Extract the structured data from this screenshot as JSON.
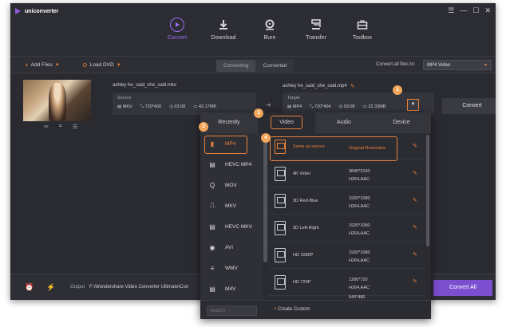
{
  "app": {
    "name": "uniconverter",
    "window_controls": [
      "☰",
      "—",
      "☐",
      "✕"
    ]
  },
  "nav": {
    "tabs": [
      {
        "label": "Convert",
        "icon": "convert-icon",
        "active": true
      },
      {
        "label": "Download",
        "icon": "download-icon"
      },
      {
        "label": "Burn",
        "icon": "burn-icon"
      },
      {
        "label": "Transfer",
        "icon": "transfer-icon"
      },
      {
        "label": "Toolbox",
        "icon": "toolbox-icon"
      }
    ]
  },
  "toolbar": {
    "add_files": "Add Files",
    "load_dvd": "Load DVD",
    "segment": [
      "Converting",
      "Converted"
    ],
    "convert_all_label": "Convert all files to:",
    "convert_all_value": "MP4 Video"
  },
  "file": {
    "source_name": "ashley he_said_she_said.mkx",
    "source_label": "Source",
    "source": {
      "format": "MKV",
      "resolution": "720*400",
      "duration": "03:08",
      "size": "42.17MB"
    },
    "target_name": "ashley he_said_she_said.mp4",
    "target_label": "Target",
    "target": {
      "format": "MP4",
      "resolution": "720*404",
      "duration": "03:08",
      "size": "22.33MB"
    },
    "convert_label": "Convert"
  },
  "bottom": {
    "output_label": "Output",
    "output_path": "F:\\Wondershare Video Converter Ultimate\\Con",
    "convert_all_label": "Convert All"
  },
  "popup": {
    "tabs": [
      "Recently",
      "Video",
      "Audio",
      "Device"
    ],
    "active_tab": "Video",
    "formats": [
      {
        "label": "MP4",
        "icon": "film-icon",
        "glyph": "▮"
      },
      {
        "label": "HEVC MP4",
        "icon": "hevc-icon",
        "glyph": "▤"
      },
      {
        "label": "MOV",
        "icon": "quicktime-icon",
        "glyph": "Q"
      },
      {
        "label": "MKV",
        "icon": "mkv-icon",
        "glyph": "⎍"
      },
      {
        "label": "HEVC MKV",
        "icon": "hevc-icon",
        "glyph": "▤"
      },
      {
        "label": "AVI",
        "icon": "play-circle-icon",
        "glyph": "◉"
      },
      {
        "label": "WMV",
        "icon": "wmv-icon",
        "glyph": "≡"
      },
      {
        "label": "M4V",
        "icon": "m4v-icon",
        "glyph": "▤"
      }
    ],
    "resolutions": [
      {
        "name": "Same as source",
        "size": "Original Resolution",
        "codec": ""
      },
      {
        "name": "4K Video",
        "size": "3840*2160",
        "codec": "H264,AAC"
      },
      {
        "name": "3D Red-Blue",
        "size": "1920*1080",
        "codec": "H264,AAC"
      },
      {
        "name": "3D Left-Right",
        "size": "1920*1080",
        "codec": "H264,AAC"
      },
      {
        "name": "HD 1080P",
        "size": "1920*1080",
        "codec": "H264,AAC"
      },
      {
        "name": "HD 720P",
        "size": "1280*720",
        "codec": "H264,AAC"
      },
      {
        "name": "",
        "size": "640*480",
        "codec": ""
      }
    ],
    "search_placeholder": "Search",
    "create_custom": "Create Custom"
  },
  "callouts": [
    "1",
    "2",
    "3",
    "4"
  ],
  "colors": {
    "accent": "#e8823a",
    "brand": "#8f5bd9",
    "primary_button": "#7c4fd0",
    "callout": "#f2a65a"
  }
}
